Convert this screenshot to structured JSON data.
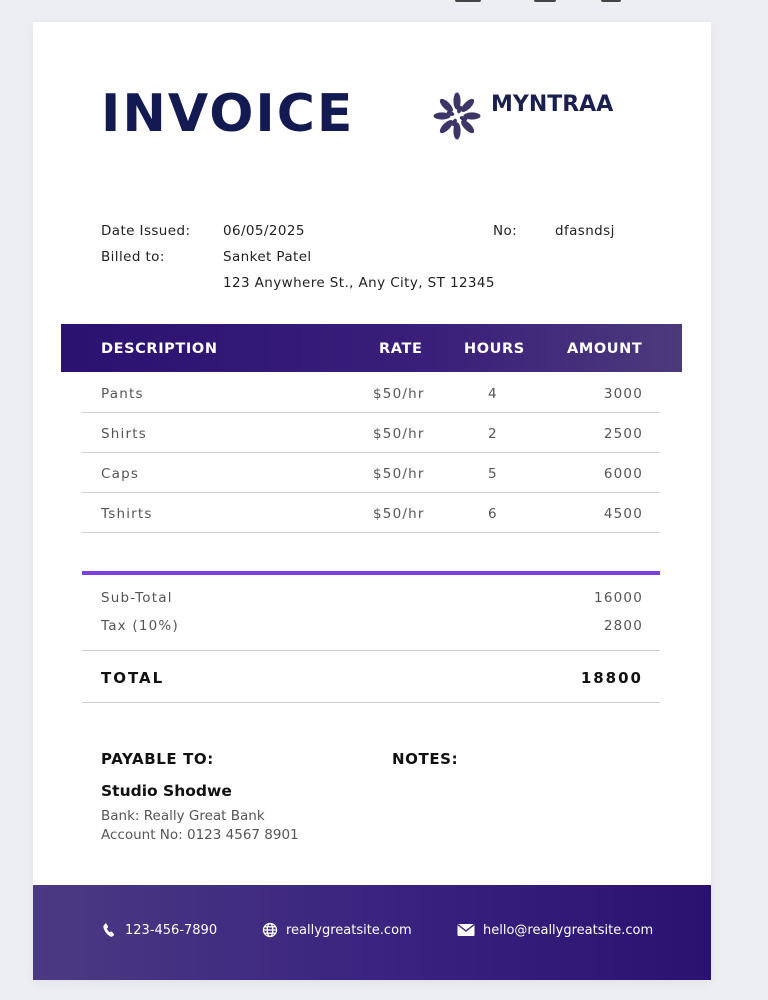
{
  "invoice": {
    "title": "INVOICE",
    "brand": "MYNTRAA",
    "meta": {
      "date_label": "Date Issued:",
      "date_value": "06/05/2025",
      "no_label": "No:",
      "no_value": "dfasndsj",
      "billed_label": "Billed to:",
      "billed_name": "Sanket Patel",
      "billed_address": "123 Anywhere St., Any City, ST 12345"
    },
    "table": {
      "headers": [
        "DESCRIPTION",
        "RATE",
        "HOURS",
        "AMOUNT"
      ],
      "rows": [
        {
          "description": "Pants",
          "rate": "$50/hr",
          "hours": "4",
          "amount": "3000"
        },
        {
          "description": "Shirts",
          "rate": "$50/hr",
          "hours": "2",
          "amount": "2500"
        },
        {
          "description": "Caps",
          "rate": "$50/hr",
          "hours": "5",
          "amount": "6000"
        },
        {
          "description": "Tshirts",
          "rate": "$50/hr",
          "hours": "6",
          "amount": "4500"
        }
      ]
    },
    "summary": {
      "subtotal_label": "Sub-Total",
      "subtotal_value": "16000",
      "tax_label": "Tax (10%)",
      "tax_value": "2800",
      "total_label": "TOTAL",
      "total_value": "18800"
    },
    "payable": {
      "heading": "PAYABLE TO:",
      "name": "Studio Shodwe",
      "bank": "Bank: Really Great Bank",
      "account": "Account No: 0123 4567 8901"
    },
    "notes": {
      "heading": "NOTES:"
    },
    "footer": {
      "phone": "123-456-7890",
      "website": "reallygreatsite.com",
      "email": "hello@reallygreatsite.com"
    }
  },
  "colors": {
    "title": "#131a52",
    "header_gradient_start": "#2b1170",
    "accent_line": "#7b3fe4",
    "logo": "#3d3566"
  },
  "icons": {
    "logo": "flower-logo-icon",
    "phone": "phone-icon",
    "website": "globe-icon",
    "email": "mail-icon"
  }
}
